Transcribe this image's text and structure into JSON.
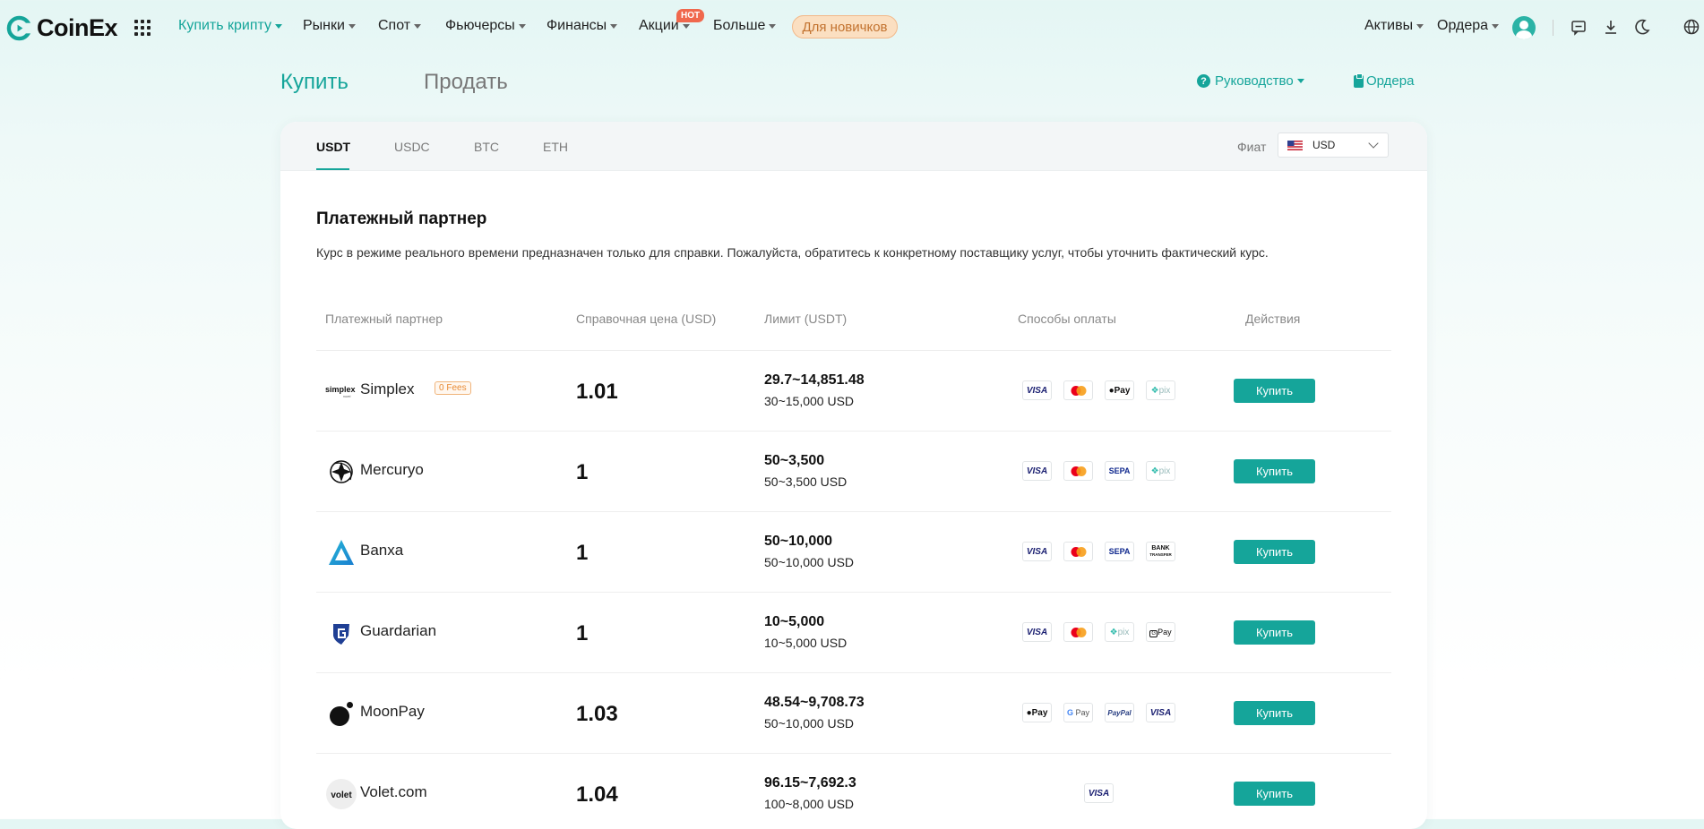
{
  "brand": {
    "name": "CoinEx",
    "accent": "#15a59a"
  },
  "nav": {
    "items": [
      {
        "label": "Купить крипту",
        "active": true
      },
      {
        "label": "Рынки"
      },
      {
        "label": "Спот"
      },
      {
        "label": "Фьючерсы"
      },
      {
        "label": "Финансы"
      },
      {
        "label": "Акции"
      },
      {
        "label": "Больше"
      }
    ],
    "hot_badge": "HOT",
    "beginner": "Для новичков",
    "right": {
      "assets": "Активы",
      "orders": "Ордера"
    },
    "icons": [
      "chat-icon",
      "download-icon",
      "moon-icon",
      "globe-icon"
    ]
  },
  "header": {
    "buy_tab": "Купить",
    "sell_tab": "Продать",
    "guide": "Руководство",
    "orders": "Ордера"
  },
  "coins": {
    "tabs": [
      "USDT",
      "USDC",
      "BTC",
      "ETH"
    ],
    "active": "USDT",
    "fiat_label": "Фиат",
    "fiat_value": "USD"
  },
  "partners": {
    "title": "Платежный партнер",
    "description": "Курс в режиме реального времени предназначен только для справки. Пожалуйста, обратитесь к конкретному поставщику услуг, чтобы уточнить фактический курс.",
    "columns": [
      "Платежный партнер",
      "Справочная цена (USD)",
      "Лимит (USDT)",
      "Способы оплаты",
      "Действия"
    ],
    "buy_label": "Купить",
    "rows": [
      {
        "name": "Simplex",
        "logo": "simplex",
        "logo_text": "simplex",
        "badge": "0 Fees",
        "price": "1.01",
        "limit": "29.7~14,851.48",
        "limit_fiat": "30~15,000 USD",
        "methods": [
          "visa",
          "mastercard",
          "applepay",
          "pix"
        ]
      },
      {
        "name": "Mercuryo",
        "logo": "mercuryo",
        "price": "1",
        "limit": "50~3,500",
        "limit_fiat": "50~3,500 USD",
        "methods": [
          "visa",
          "mastercard",
          "sepa",
          "pix"
        ]
      },
      {
        "name": "Banxa",
        "logo": "banxa",
        "price": "1",
        "limit": "50~10,000",
        "limit_fiat": "50~10,000 USD",
        "methods": [
          "visa",
          "mastercard",
          "sepa",
          "bank"
        ]
      },
      {
        "name": "Guardarian",
        "logo": "guardarian",
        "price": "1",
        "limit": "10~5,000",
        "limit_fiat": "10~5,000 USD",
        "methods": [
          "visa",
          "mastercard",
          "pix",
          "gpay-mini"
        ]
      },
      {
        "name": "MoonPay",
        "logo": "moonpay",
        "price": "1.03",
        "limit": "48.54~9,708.73",
        "limit_fiat": "50~10,000 USD",
        "methods": [
          "applepay",
          "googlepay",
          "paypal",
          "visa"
        ]
      },
      {
        "name": "Volet.com",
        "logo": "volet",
        "logo_text": "volet",
        "price": "1.04",
        "limit": "96.15~7,692.3",
        "limit_fiat": "100~8,000 USD",
        "methods": [
          "visa"
        ]
      }
    ]
  },
  "payment_labels": {
    "visa": "VISA",
    "applepay": "Pay",
    "googlepay": "G Pay",
    "paypal": "PayPal",
    "sepa": "SEPA",
    "bank": [
      "BANK",
      "TRANSFER"
    ],
    "pix": "pix",
    "gpay-mini": "Pay"
  }
}
